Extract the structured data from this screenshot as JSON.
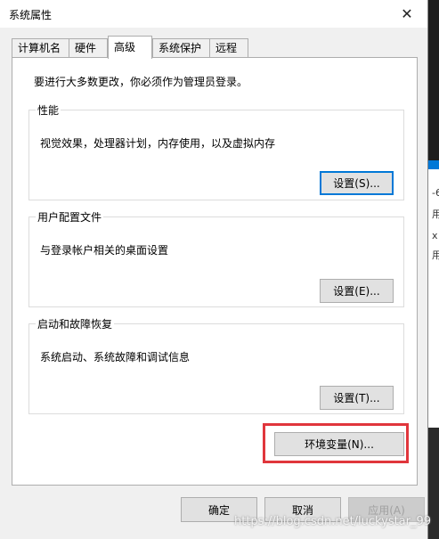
{
  "window": {
    "title": "系统属性",
    "close_glyph": "✕"
  },
  "tabs": [
    {
      "label": "计算机名"
    },
    {
      "label": "硬件"
    },
    {
      "label": "高级",
      "active": true
    },
    {
      "label": "系统保护"
    },
    {
      "label": "远程"
    }
  ],
  "panel": {
    "intro": "要进行大多数更改，你必须作为管理员登录。",
    "performance": {
      "legend": "性能",
      "description": "视觉效果，处理器计划，内存使用，以及虚拟内存",
      "button": "设置(S)..."
    },
    "user_profiles": {
      "legend": "用户配置文件",
      "description": "与登录帐户相关的桌面设置",
      "button": "设置(E)..."
    },
    "startup_recovery": {
      "legend": "启动和故障恢复",
      "description": "系统启动、系统故障和调试信息",
      "button": "设置(T)..."
    },
    "env_button": "环境变量(N)..."
  },
  "footer": {
    "ok": "确定",
    "cancel": "取消",
    "apply": "应用(A)"
  },
  "watermark": "https://blog.csdn.net/luckystar_99",
  "background_glyphs": [
    "-6",
    "用",
    "x",
    "用"
  ],
  "colors": {
    "highlight_border": "#e0363c",
    "focus_blue": "#0078d7"
  }
}
